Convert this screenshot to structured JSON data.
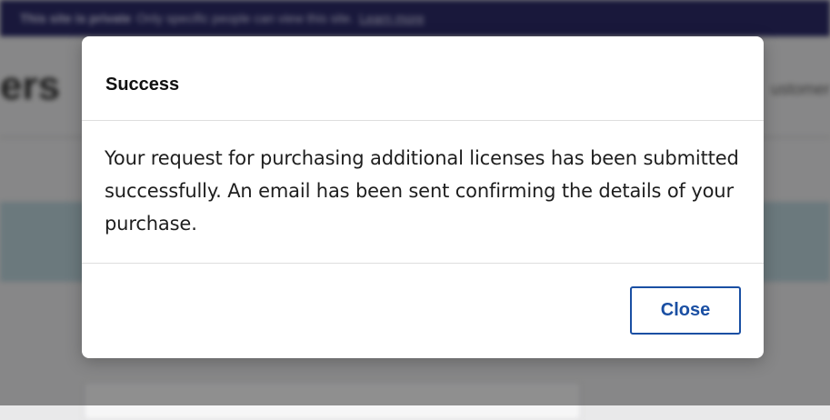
{
  "background": {
    "banner": {
      "strong": "This site is private",
      "text": "Only specific people can view this site.",
      "link": "Learn more"
    },
    "page_heading": "ers",
    "page_sub": "ustomer"
  },
  "modal": {
    "title": "Success",
    "message": "Your request for purchasing additional licenses has been submitted successfully. An email has been sent confirming the details of your purchase.",
    "close_label": "Close"
  },
  "colors": {
    "banner_bg": "#2b2a66",
    "primary": "#1a4fa3",
    "overlay": "rgba(0,0,0,0.42)"
  }
}
